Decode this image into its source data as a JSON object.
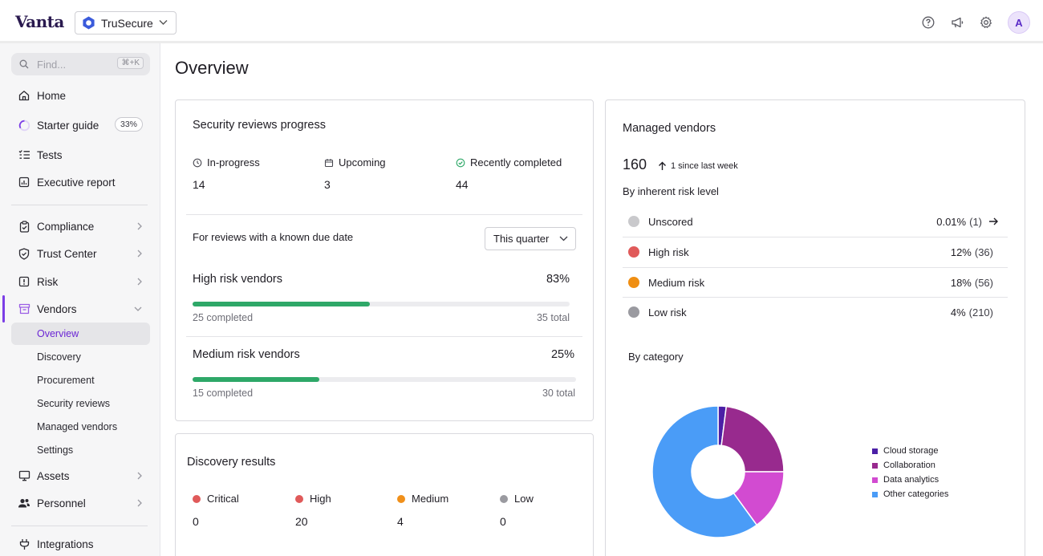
{
  "app": {
    "logo": "Vanta",
    "org_name": "TruSecure",
    "avatar_initial": "A"
  },
  "colors": {
    "accent": "#7b3ee6",
    "progress_green": "#2ea868",
    "critical": "#e05a5a",
    "high": "#e05a5a",
    "medium": "#f0901a",
    "low": "#9a9aa0",
    "unscored": "#c9c9cc",
    "high_risk": "#e05a5a",
    "medium_risk": "#ef8e12",
    "low_risk": "#9a9aa0"
  },
  "header": {
    "icons": [
      "help-icon",
      "megaphone-icon",
      "gear-icon"
    ]
  },
  "sidebar": {
    "search_placeholder": "Find...",
    "search_shortcut": "⌘+K",
    "items": [
      {
        "label": "Home",
        "icon": "home-icon"
      },
      {
        "label": "Starter guide",
        "icon": "progress-ring-icon",
        "badge": "33%"
      },
      {
        "label": "Tests",
        "icon": "checklist-icon"
      },
      {
        "label": "Executive report",
        "icon": "report-icon"
      },
      {
        "label": "Compliance",
        "icon": "clipboard-icon"
      },
      {
        "label": "Trust Center",
        "icon": "shield-icon"
      },
      {
        "label": "Risk",
        "icon": "alert-box-icon"
      },
      {
        "label": "Vendors",
        "icon": "vendors-icon"
      },
      {
        "label": "Assets",
        "icon": "monitor-icon"
      },
      {
        "label": "Personnel",
        "icon": "people-icon"
      },
      {
        "label": "Integrations",
        "icon": "plug-icon"
      }
    ],
    "vendor_subitems": [
      "Overview",
      "Discovery",
      "Procurement",
      "Security reviews",
      "Managed vendors",
      "Settings"
    ]
  },
  "main": {
    "title": "Overview",
    "security_reviews": {
      "title": "Security reviews progress",
      "stats": [
        {
          "label": "In-progress",
          "value": "14",
          "icon": "clock-icon"
        },
        {
          "label": "Upcoming",
          "value": "3",
          "icon": "calendar-icon"
        },
        {
          "label": "Recently completed",
          "value": "44",
          "icon": "check-circle-icon"
        }
      ],
      "due_label": "For reviews with a known due date",
      "period": "This quarter",
      "progress": [
        {
          "name": "High risk vendors",
          "pct": "83%",
          "completed": "25 completed",
          "total": "35 total",
          "fill": 0.47
        },
        {
          "name": "Medium risk vendors",
          "pct": "25%",
          "completed": "15 completed",
          "total": "30 total",
          "fill": 0.33
        }
      ]
    },
    "discovery": {
      "title": "Discovery results",
      "items": [
        {
          "label": "Critical",
          "value": "0"
        },
        {
          "label": "High",
          "value": "20"
        },
        {
          "label": "Medium",
          "value": "4"
        },
        {
          "label": "Low",
          "value": "0"
        }
      ]
    },
    "managed_vendors": {
      "title": "Managed vendors",
      "count": "160",
      "since": "1 since last week",
      "by_risk_title": "By inherent risk level",
      "risk_levels": [
        {
          "name": "Unscored",
          "pct": "0.01%",
          "count": "(1)"
        },
        {
          "name": "High risk",
          "pct": "12%",
          "count": "(36)"
        },
        {
          "name": "Medium risk",
          "pct": "18%",
          "count": "(56)"
        },
        {
          "name": "Low risk",
          "pct": "4%",
          "count": "(210)"
        }
      ],
      "by_category_title": "By category"
    }
  },
  "chart_data": {
    "type": "pie",
    "title": "By category",
    "labels": [
      "Cloud storage",
      "Collaboration",
      "Data analytics",
      "Other categories"
    ],
    "values": [
      2,
      23,
      15,
      60
    ],
    "colors": [
      "#4b1fa6",
      "#982a8e",
      "#d24bd1",
      "#4a9cf7"
    ],
    "donut": true
  }
}
